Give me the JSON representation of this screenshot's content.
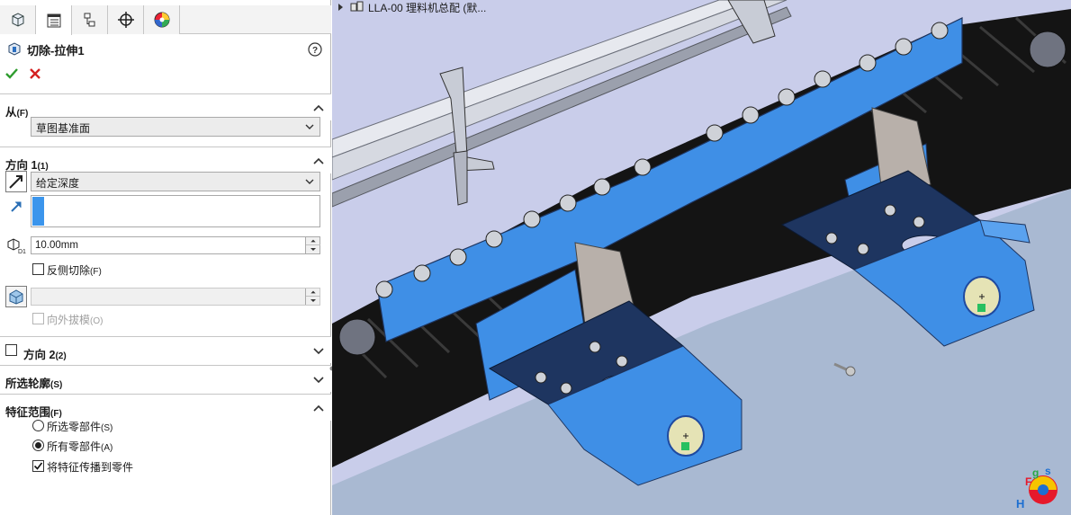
{
  "panel": {
    "tabs": [
      {
        "name": "featuremanager-tab"
      },
      {
        "name": "propertymanager-tab"
      },
      {
        "name": "configurationmanager-tab"
      },
      {
        "name": "dimxpert-tab"
      },
      {
        "name": "displaymanager-tab"
      }
    ],
    "feature_title": "切除-拉伸1",
    "from": {
      "label": "从",
      "shortcut": "(F)",
      "value": "草图基准面"
    },
    "direction1": {
      "label": "方向 1",
      "shortcut": "(1)",
      "end_condition": "给定深度",
      "depth": "10.00mm",
      "flip_label": "反侧切除",
      "flip_shortcut": "(F)",
      "flip_checked": false,
      "draft_label": "向外拔模",
      "draft_shortcut": "(O)"
    },
    "direction2": {
      "label": "方向 2",
      "shortcut": "(2)"
    },
    "selected_contours": {
      "label": "所选轮廓",
      "shortcut": "(S)"
    },
    "feature_scope": {
      "label": "特征范围",
      "shortcut": "(F)",
      "options": [
        {
          "label": "所选零部件",
          "shortcut": "(S)",
          "selected": false
        },
        {
          "label": "所有零部件",
          "shortcut": "(A)",
          "selected": true
        }
      ],
      "propagate_label": "将特征传播到零件",
      "propagate_checked": true
    }
  },
  "viewport": {
    "tree_root": "LLA-00 理料机总配 (默..."
  },
  "colors": {
    "part_blue": "#3f8fe6",
    "plate_navy": "#1e3560",
    "background_lavender": "#c9cdea",
    "accept_green": "#2e9c2e",
    "cancel_red": "#d42020"
  }
}
